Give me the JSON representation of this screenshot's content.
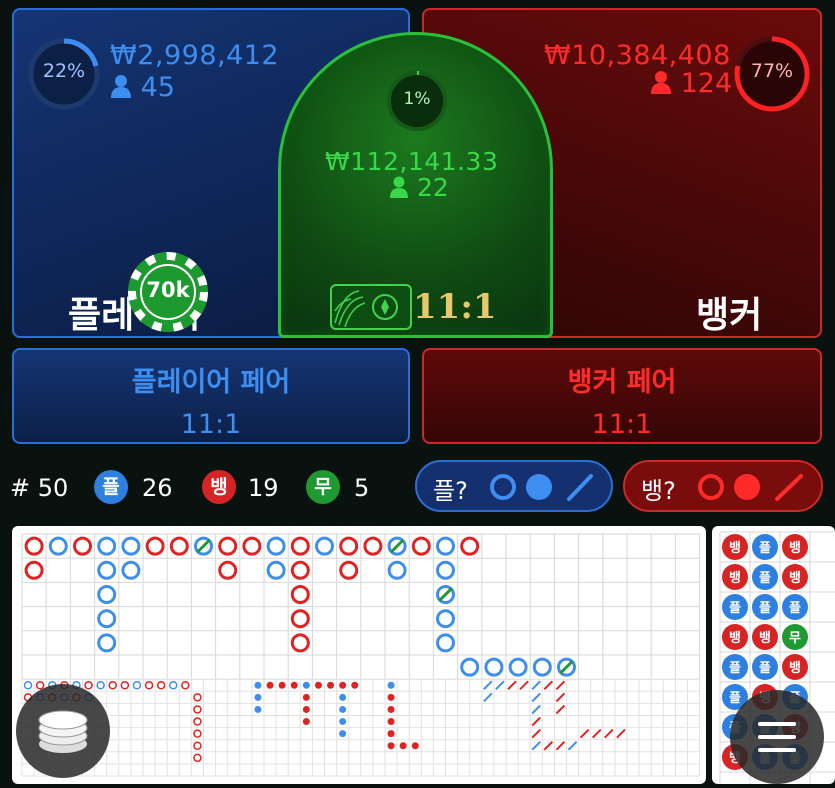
{
  "player": {
    "percent": "22%",
    "amount": "₩2,998,412",
    "bettors": "45",
    "label": "플레이어",
    "chip": "70k",
    "color": "#3d8ef0"
  },
  "tie": {
    "percent": "1%",
    "amount": "₩112,141.33",
    "bettors": "22",
    "payout": "11:1",
    "color": "#39d84a"
  },
  "banker": {
    "percent": "77%",
    "amount": "₩10,384,408",
    "bettors": "124",
    "label": "뱅커",
    "color": "#e22222"
  },
  "player_pair": {
    "label": "플레이어 페어",
    "payout": "11:1"
  },
  "banker_pair": {
    "label": "뱅커 페어",
    "payout": "11:1"
  },
  "stats": {
    "round_label": "# 50",
    "player_badge": "플",
    "player_count": "26",
    "banker_badge": "뱅",
    "banker_count": "19",
    "tie_badge": "무",
    "tie_count": "5"
  },
  "predict": {
    "player_label": "플?",
    "banker_label": "뱅?"
  },
  "bead_road_labels": {
    "player": "플",
    "banker": "뱅",
    "tie": "무"
  },
  "icons": {
    "chip_stack": "chip-stack-icon",
    "menu": "menu-icon",
    "person": "person-icon"
  }
}
